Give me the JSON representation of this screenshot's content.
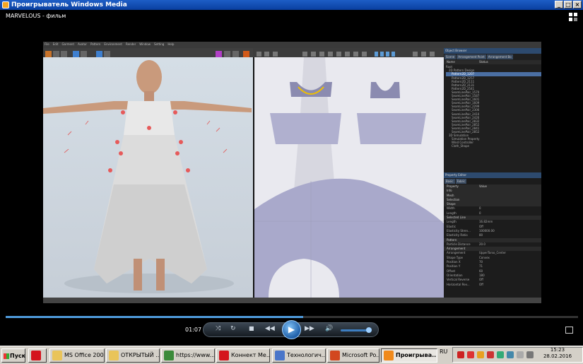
{
  "window": {
    "title": "Проигрыватель Windows Media",
    "movie_title": "MARVELOUS - фильм",
    "buttons": [
      "_",
      "□",
      "×"
    ]
  },
  "app_menu": [
    "File",
    "Edit",
    "Garment",
    "Avatar",
    "Pattern",
    "Environment",
    "Render",
    "Window",
    "Setting",
    "Help"
  ],
  "object_browser": {
    "title": "Object Browser",
    "tabs": [
      "Scene",
      "Arrangement Point",
      "Arrangement Bo"
    ],
    "columns": [
      "Name",
      "Status"
    ],
    "items": [
      "Root",
      "2D Pattern Design",
      "Pattern2D_1207",
      "Pattern2D_1257",
      "Pattern2D_2111",
      "Pattern2D_2131",
      "Pattern2D_2541",
      "SeamLinePair_1570",
      "SeamLinePair_1587",
      "SeamLinePair_1601",
      "SeamLinePair_1609",
      "SeamLinePair_2299",
      "SeamLinePair_2306",
      "SeamLinePair_2410",
      "SeamLinePair_2426",
      "SeamLinePair_2832",
      "SeamLinePair_2852",
      "SeamLinePair_2841",
      "SeamLinePair_2852",
      "3D Simulation",
      "Simulation Property",
      "Wind Controller",
      "Cloth_Shape"
    ],
    "selected_index": 2
  },
  "property_editor": {
    "title": "Property Editor",
    "tabs": [
      "Basic",
      "Fabric"
    ],
    "columns": [
      "Property",
      "Value"
    ],
    "rows": [
      [
        "Property",
        "Value"
      ],
      [
        "Info",
        ""
      ],
      [
        "Mesh",
        ""
      ],
      [
        "Selection",
        ""
      ],
      [
        "Shape",
        ""
      ],
      [
        "Width",
        "0"
      ],
      [
        "Length",
        "0"
      ],
      [
        "Selected Line",
        ""
      ],
      [
        "Length",
        "16.82mm"
      ],
      [
        "Elastic",
        "Off"
      ],
      [
        "Elasticity Stren...",
        "100000.00"
      ],
      [
        "Elasticity Ratio",
        "80"
      ],
      [
        "Pattern",
        ""
      ],
      [
        "Particle Distance",
        "20.0"
      ],
      [
        "Arrangement",
        ""
      ],
      [
        "Arrangement",
        "UpperTorso_Center"
      ],
      [
        "Shape Type",
        "Convex"
      ],
      [
        "Position X",
        "70"
      ],
      [
        "Position Y",
        "71"
      ],
      [
        "Offset",
        "60"
      ],
      [
        "Orientation",
        "180"
      ],
      [
        "Vertical Reverse",
        "Off"
      ],
      [
        "Horizontal Rev...",
        "Off"
      ]
    ],
    "section_rows": [
      1,
      2,
      3,
      4,
      7,
      12,
      14
    ]
  },
  "player": {
    "elapsed": "01:07",
    "progress_fraction": 0.52,
    "volume_fraction": 0.85,
    "controls": [
      "shuffle",
      "repeat",
      "stop",
      "rewind",
      "play",
      "fast-forward",
      "volume"
    ]
  },
  "taskbar": {
    "start_label": "Пуск",
    "buttons": [
      {
        "label": "",
        "icon": "opera-icon",
        "color": "#d4141e"
      },
      {
        "label": "MS Office  2007",
        "icon": "folder-icon",
        "color": "#e9c45a"
      },
      {
        "label": "ОТКРЫТЫЙ ...",
        "icon": "folder-icon",
        "color": "#e9c45a"
      },
      {
        "label": "https://www....",
        "icon": "chrome-icon",
        "color": "#3b8a3a"
      },
      {
        "label": "Коннект Ме...",
        "icon": "opera-icon",
        "color": "#d4141e"
      },
      {
        "label": "Технологич...",
        "icon": "document-icon",
        "color": "#4a76c9"
      },
      {
        "label": "Microsoft Po...",
        "icon": "powerpoint-icon",
        "color": "#d2471f"
      },
      {
        "label": "Проигрыва...",
        "icon": "media-player-icon",
        "color": "#f08a1c",
        "active": true
      }
    ],
    "language": "RU",
    "clock_time": "15:23",
    "clock_date": "28.02.2016"
  }
}
